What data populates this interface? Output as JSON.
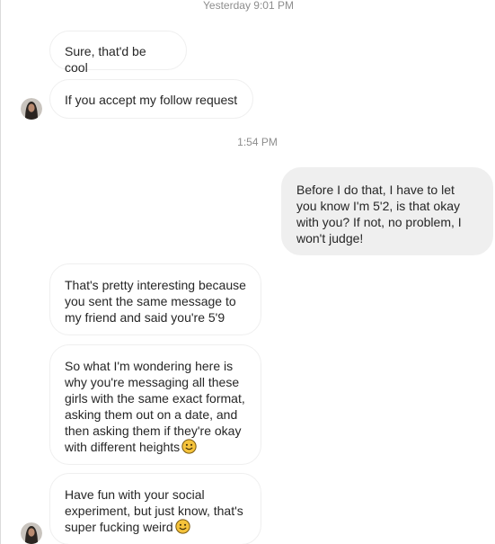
{
  "timestamps": {
    "yesterday": "Yesterday 9:01 PM",
    "today": "1:54 PM"
  },
  "messages": [
    {
      "side": "received",
      "text": "Sure, that'd be cool"
    },
    {
      "side": "received",
      "text": "If you accept my follow request"
    },
    {
      "side": "sent",
      "text": "Before I do that, I have to let\nyou know I'm 5'2, is that okay\nwith you? If not, no problem, I\nwon't judge!"
    },
    {
      "side": "received",
      "text": "That's pretty interesting because\nyou sent the same message to\nmy friend and said you're 5'9"
    },
    {
      "side": "received",
      "text": "So what I'm wondering here is\nwhy you're messaging all these\ngirls with the same exact format,\nasking them out on a date, and\nthen asking them if they're okay\nwith different heights",
      "trailing_emoji": "slightly-smiling-face"
    },
    {
      "side": "received",
      "text": "Have fun with your social\nexperiment, but just know, that's\nsuper fucking weird",
      "trailing_emoji": "slightly-smiling-face"
    }
  ],
  "colors": {
    "sent_bubble": "#efefef",
    "received_border": "#efefef",
    "timestamp": "#8e8e8e",
    "emoji": "#f5c33b"
  }
}
